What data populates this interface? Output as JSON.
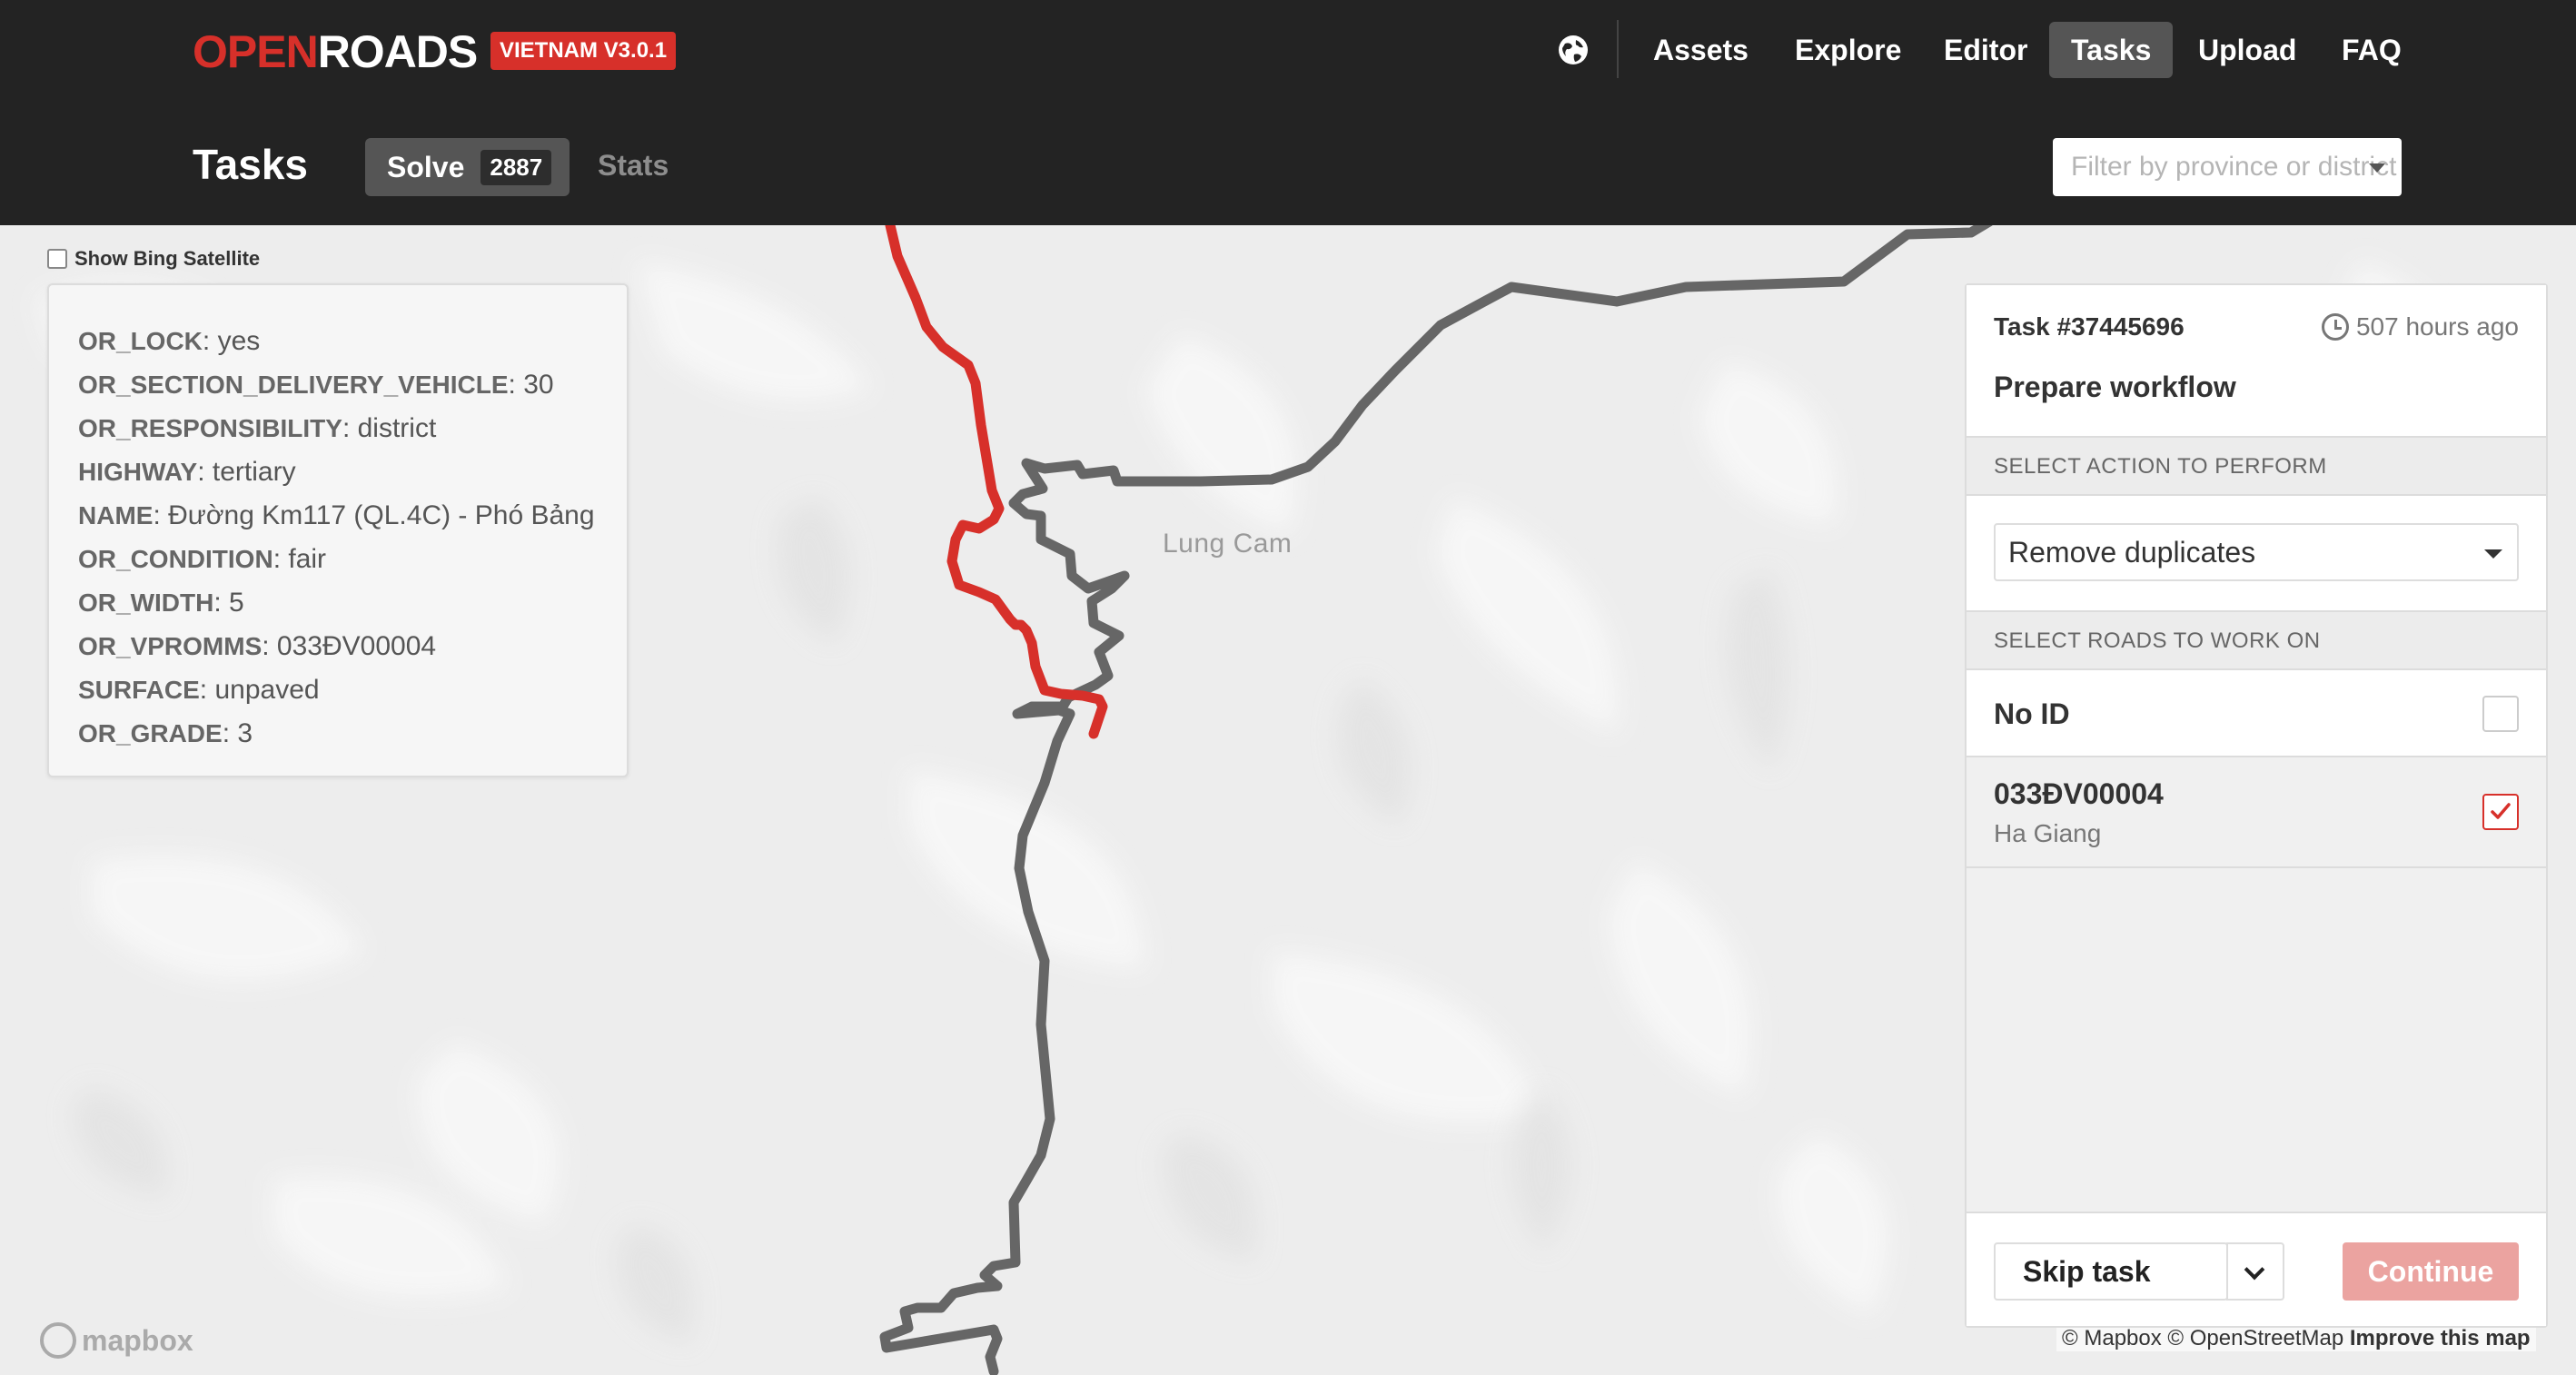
{
  "header": {
    "logo_open": "OPEN",
    "logo_roads": "ROADS",
    "version": "VIETNAM V3.0.1",
    "nav": [
      {
        "label": "Assets",
        "active": false
      },
      {
        "label": "Explore",
        "active": false
      },
      {
        "label": "Editor",
        "active": false
      },
      {
        "label": "Tasks",
        "active": true
      },
      {
        "label": "Upload",
        "active": false
      },
      {
        "label": "FAQ",
        "active": false
      }
    ],
    "language_icon": "globe-icon",
    "page_title": "Tasks",
    "tabs": {
      "solve_label": "Solve",
      "solve_count": "2887",
      "stats_label": "Stats"
    },
    "filter_placeholder": "Filter by province or district"
  },
  "map": {
    "satellite_toggle_label": "Show Bing Satellite",
    "satellite_checked": false,
    "place_label": "Lung Cam",
    "properties": [
      {
        "key": "OR_LOCK",
        "value": "yes"
      },
      {
        "key": "OR_SECTION_DELIVERY_VEHICLE",
        "value": "30"
      },
      {
        "key": "OR_RESPONSIBILITY",
        "value": "district"
      },
      {
        "key": "HIGHWAY",
        "value": "tertiary"
      },
      {
        "key": "NAME",
        "value": "Đường Km117 (QL.4C) - Phó Bảng"
      },
      {
        "key": "OR_CONDITION",
        "value": "fair"
      },
      {
        "key": "OR_WIDTH",
        "value": "5"
      },
      {
        "key": "OR_VPROMMS",
        "value": "033ĐV00004"
      },
      {
        "key": "SURFACE",
        "value": "unpaved"
      },
      {
        "key": "OR_GRADE",
        "value": "3"
      }
    ],
    "mapbox_logo": "mapbox",
    "attribution": "© Mapbox © OpenStreetMap",
    "improve_link": "Improve this map",
    "colors": {
      "selected_road": "#d7302a",
      "other_road": "#666666"
    }
  },
  "task": {
    "id": "Task #37445696",
    "age": "507 hours ago",
    "type": "Prepare workflow",
    "action_section": "SELECT ACTION TO PERFORM",
    "action_value": "Remove duplicates",
    "roads_section": "SELECT ROADS TO WORK ON",
    "roads": [
      {
        "name": "No ID",
        "province": "",
        "checked": false
      },
      {
        "name": "033ĐV00004",
        "province": "Ha Giang",
        "checked": true
      }
    ],
    "skip_label": "Skip task",
    "continue_label": "Continue"
  },
  "colors": {
    "brand_red": "#d7302a",
    "topbar": "#232323",
    "active_tab": "#555555"
  }
}
